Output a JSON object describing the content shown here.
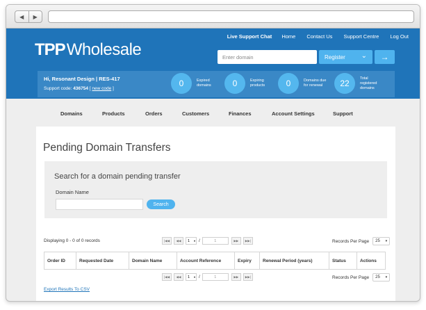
{
  "browser": {
    "back_glyph": "◀",
    "forward_glyph": "▶",
    "url": ""
  },
  "header": {
    "live_support": "Live Support Chat",
    "links": [
      "Home",
      "Contact Us",
      "Support Centre",
      "Log Out"
    ],
    "logo_bold": "TPP",
    "logo_text": "Wholesale",
    "domain_placeholder": "Enter domain",
    "register_label": "Register",
    "go_glyph": "→"
  },
  "account": {
    "greeting": "Hi, Resonant Design | RES-417",
    "support_code_label": "Support code:",
    "support_code": "436754",
    "new_code": "new code"
  },
  "stats": [
    {
      "value": "0",
      "label": "Expired domains"
    },
    {
      "value": "0",
      "label": "Expiring products"
    },
    {
      "value": "0",
      "label": "Domains due for renewal"
    },
    {
      "value": "22",
      "label": "Total registered domains"
    }
  ],
  "nav": [
    "Domains",
    "Products",
    "Orders",
    "Customers",
    "Finances",
    "Account Settings",
    "Support"
  ],
  "page": {
    "title": "Pending Domain Transfers",
    "search_header": "Search for a domain pending transfer",
    "domain_name_label": "Domain Name",
    "search_button": "Search",
    "displaying": "Displaying 0 - 0 of 0 records",
    "records_per_page_label": "Records Per Page",
    "records_per_page": "25",
    "pager": {
      "first": "|◀◀",
      "prev": "◀◀",
      "page": "1",
      "slash": "/",
      "total": "1",
      "next": "▶▶",
      "last": "▶▶|"
    },
    "columns": [
      "Order ID",
      "Requested Date",
      "Domain Name",
      "Account Reference",
      "Expiry",
      "Renewal Period (years)",
      "Status",
      "Actions"
    ],
    "export": "Export Results To CSV"
  },
  "colors": {
    "brand": "#1f74b9",
    "accent": "#4fb3ee",
    "info_bar": "#3a88c6"
  }
}
